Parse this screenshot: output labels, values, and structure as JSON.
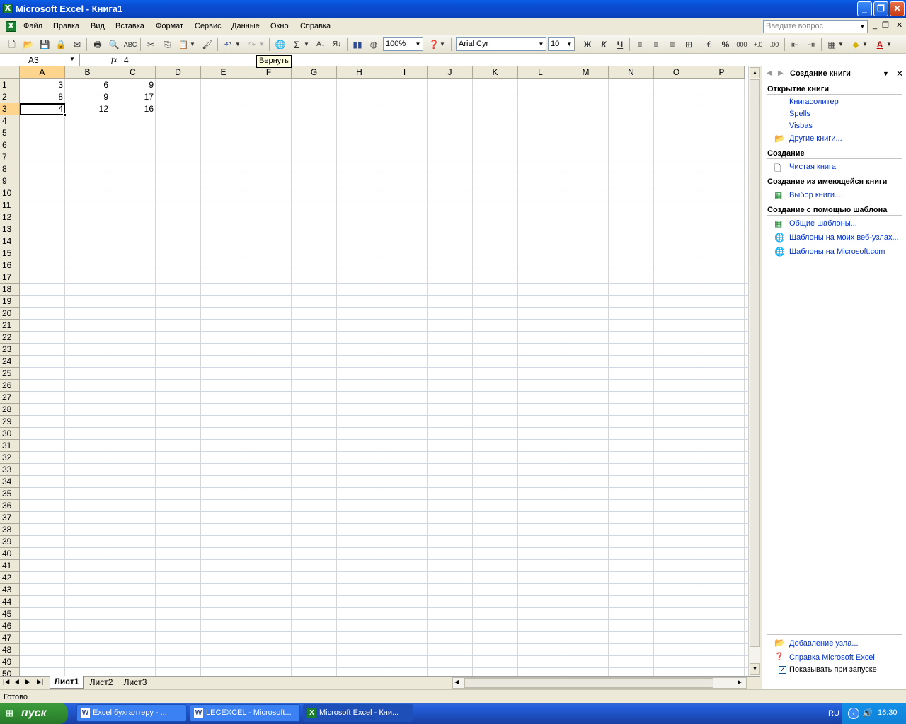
{
  "window": {
    "title": "Microsoft Excel - Книга1",
    "app_icon": "excel-icon"
  },
  "menu": {
    "items": [
      "Файл",
      "Правка",
      "Вид",
      "Вставка",
      "Формат",
      "Сервис",
      "Данные",
      "Окно",
      "Справка"
    ],
    "help_placeholder": "Введите вопрос"
  },
  "toolbar": {
    "zoom": "100%",
    "font": "Arial Cyr",
    "font_size": "10",
    "bold": "Ж",
    "italic": "К",
    "underline": "Ч",
    "percent": "%",
    "thousands": "000",
    "tooltip": "Вернуть"
  },
  "formula_bar": {
    "name_box": "A3",
    "fx": "fx",
    "value": "4"
  },
  "columns": [
    "A",
    "B",
    "C",
    "D",
    "E",
    "F",
    "G",
    "H",
    "I",
    "J",
    "K",
    "L",
    "M",
    "N",
    "O",
    "P"
  ],
  "rows": [
    "1",
    "2",
    "3",
    "4",
    "5",
    "6",
    "7",
    "8",
    "9",
    "10",
    "11",
    "12",
    "13",
    "14",
    "15",
    "16",
    "17",
    "18",
    "19",
    "20",
    "21",
    "22",
    "23",
    "24",
    "25",
    "26",
    "27",
    "28",
    "29",
    "30",
    "31",
    "32",
    "33",
    "34",
    "35",
    "36",
    "37",
    "38",
    "39",
    "40",
    "41",
    "42",
    "43",
    "44",
    "45",
    "46",
    "47",
    "48",
    "49",
    "50"
  ],
  "cells": [
    [
      "3",
      "6",
      "9"
    ],
    [
      "8",
      "9",
      "17"
    ],
    [
      "4",
      "12",
      "16"
    ]
  ],
  "sheets": {
    "tabs": [
      "Лист1",
      "Лист2",
      "Лист3"
    ],
    "active": "Лист1"
  },
  "task_pane": {
    "title": "Создание книги",
    "open_heading": "Открытие книги",
    "recent": [
      "Книгасолитер",
      "Spells",
      "Visbas"
    ],
    "other_books": "Другие книги...",
    "create_heading": "Создание",
    "blank": "Чистая книга",
    "from_existing_heading": "Создание из имеющейся книги",
    "choose_book": "Выбор книги...",
    "template_heading": "Создание с помощью шаблона",
    "general_templates": "Общие шаблоны...",
    "web_templates": "Шаблоны на моих веб-узлах...",
    "ms_templates": "Шаблоны на Microsoft.com",
    "add_site": "Добавление узла...",
    "help": "Справка Microsoft Excel",
    "show_at_startup": "Показывать при запуске"
  },
  "status": {
    "text": "Готово"
  },
  "taskbar": {
    "start": "пуск",
    "tasks": [
      "Excel бухгалтеру - ...",
      "LECEXCEL - Microsoft...",
      "Microsoft Excel - Кни..."
    ],
    "lang": "RU",
    "time": "16:30"
  }
}
